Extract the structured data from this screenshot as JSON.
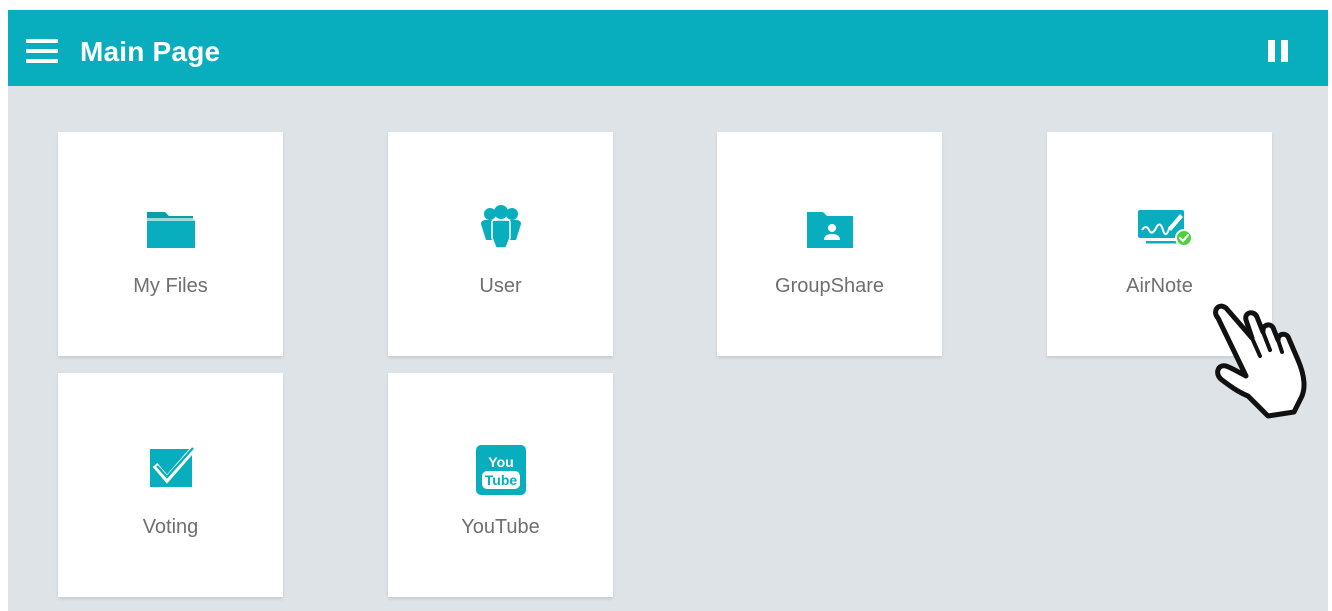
{
  "header": {
    "title": "Main Page",
    "menu_icon": "hamburger-menu-icon",
    "right_icon": "pause-icon"
  },
  "tiles": [
    {
      "label": "My Files",
      "icon": "folder-icon"
    },
    {
      "label": "User",
      "icon": "users-group-icon"
    },
    {
      "label": "GroupShare",
      "icon": "shared-folder-icon"
    },
    {
      "label": "AirNote",
      "icon": "airnote-icon"
    },
    {
      "label": "Voting",
      "icon": "checkbox-icon"
    },
    {
      "label": "YouTube",
      "icon": "youtube-icon"
    }
  ],
  "youtube_logo": {
    "line1": "You",
    "line2": "Tube"
  },
  "colors": {
    "accent": "#08aebd",
    "background": "#dde3e7",
    "tile": "#ffffff",
    "label": "#6f6f6f",
    "badge": "#4cd137"
  }
}
